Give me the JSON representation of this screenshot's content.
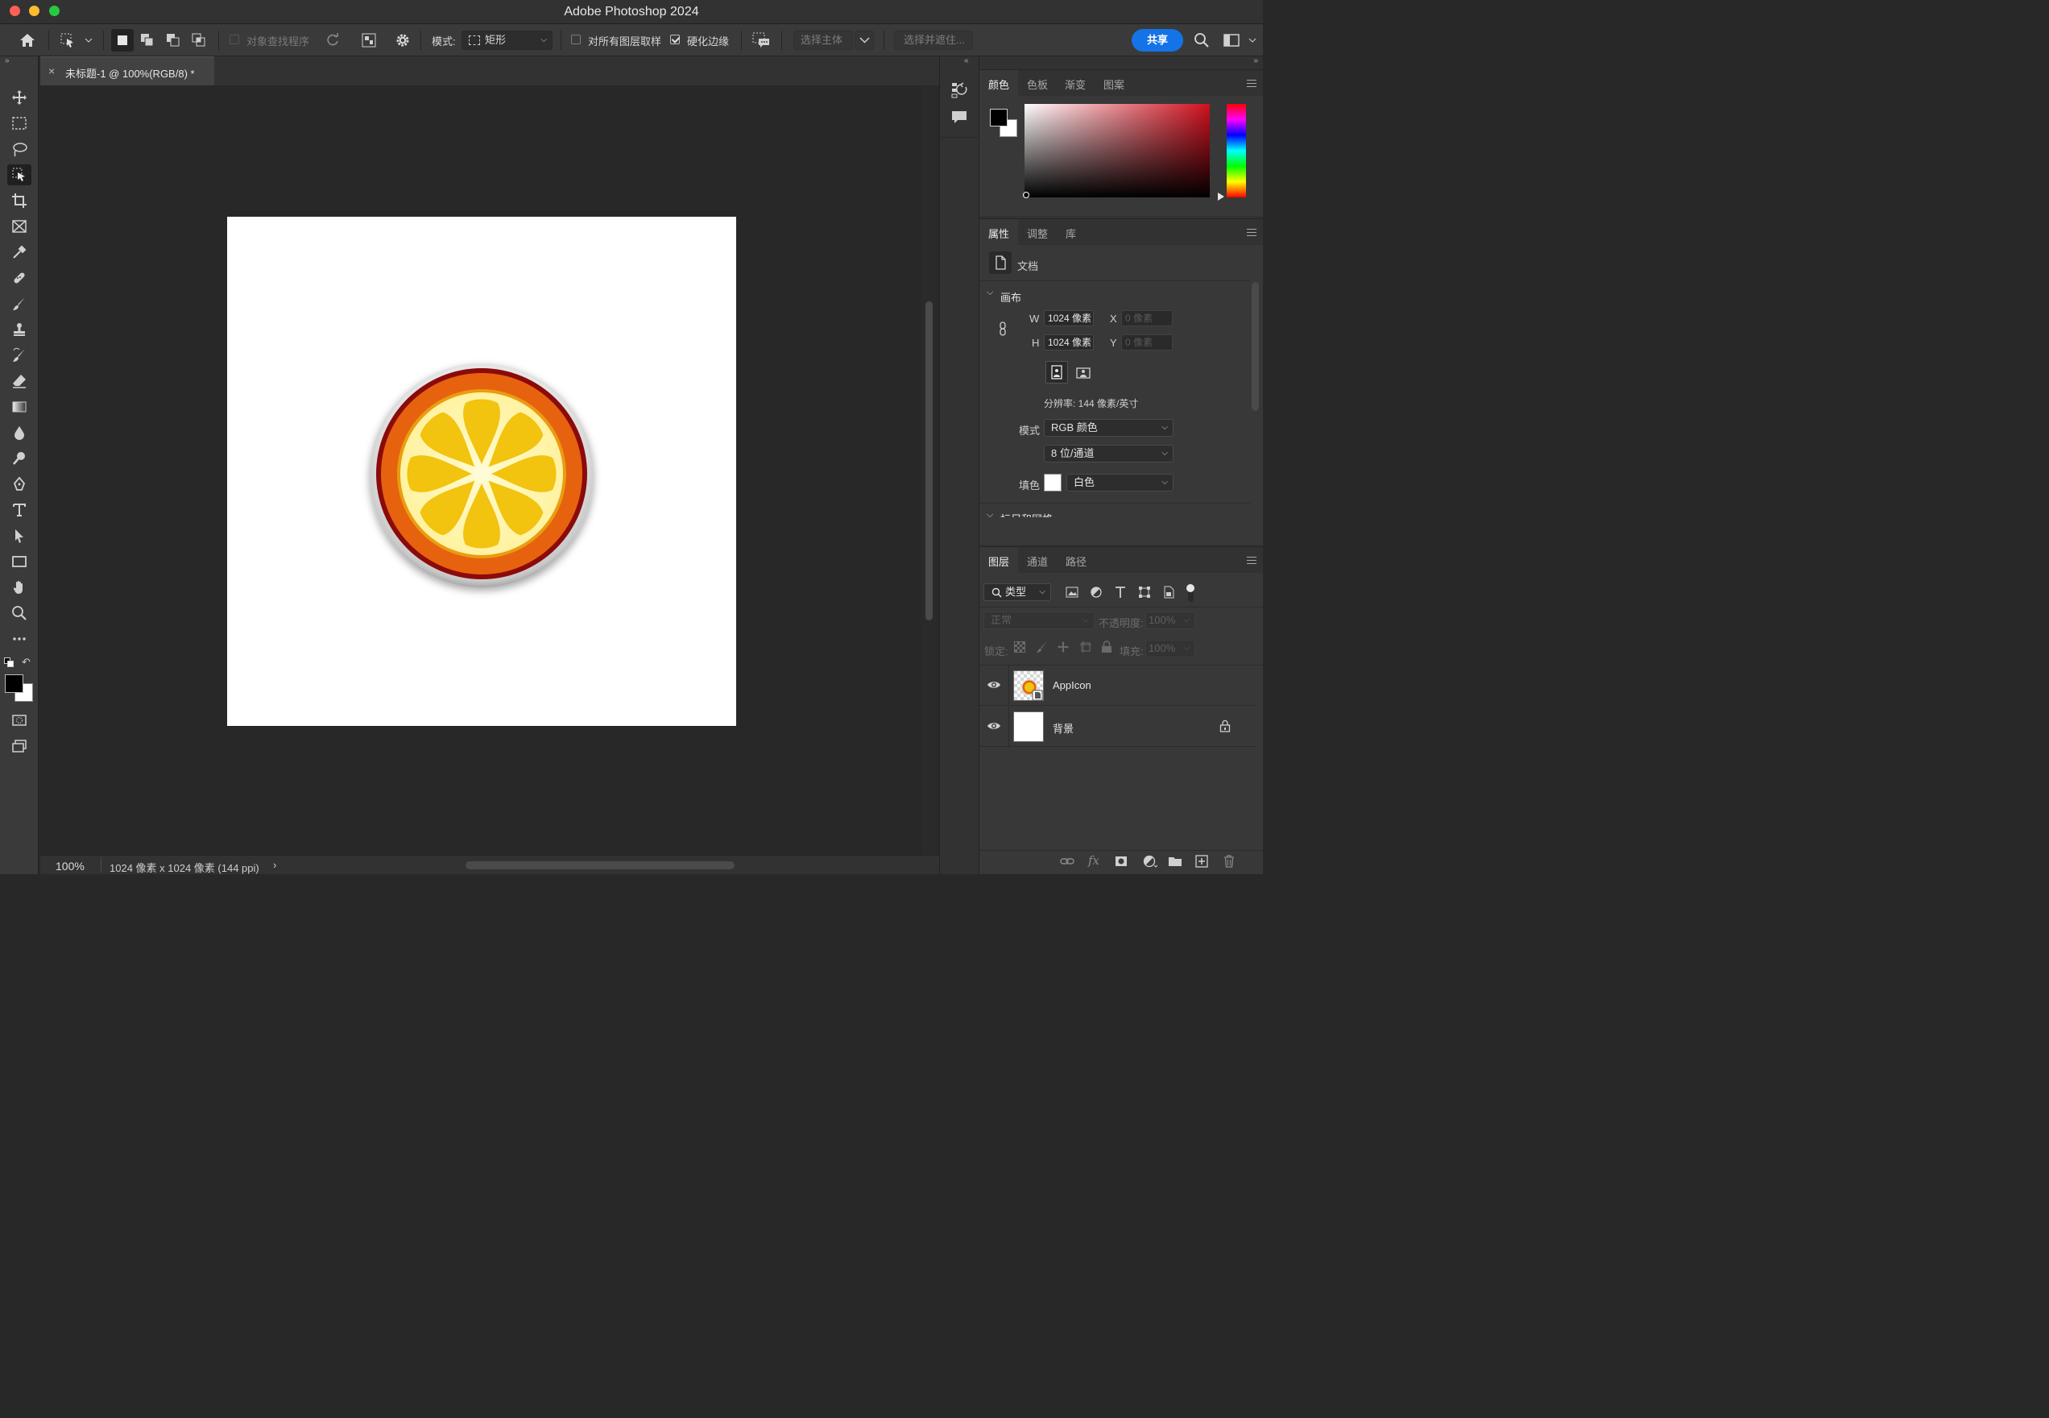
{
  "app": {
    "title": "Adobe Photoshop 2024"
  },
  "options_bar": {
    "object_finder_label": "对象查找程序",
    "mode_label": "模式:",
    "mode_value": "矩形",
    "sample_all_layers_label": "对所有图层取样",
    "sample_all_layers_checked": false,
    "hard_edge_label": "硬化边缘",
    "hard_edge_checked": true,
    "select_subject_label": "选择主体",
    "select_and_mask_label": "选择并遮住...",
    "share_label": "共享"
  },
  "document": {
    "tab_title": "未标题-1 @ 100%(RGB/8) *",
    "zoom": "100%",
    "status_info": "1024 像素 x 1024 像素 (144 ppi)"
  },
  "color_panel": {
    "tabs": [
      "颜色",
      "色板",
      "渐变",
      "图案"
    ],
    "active_tab": "颜色",
    "foreground": "#000000",
    "background": "#ffffff",
    "hue_color": "#d0101e"
  },
  "properties_panel": {
    "tabs": [
      "属性",
      "调整",
      "库"
    ],
    "active_tab": "属性",
    "doc_label": "文档",
    "canvas_section": "画布",
    "w_label": "W",
    "w_value": "1024 像素",
    "h_label": "H",
    "h_value": "1024 像素",
    "x_label": "X",
    "x_placeholder": "0 像素",
    "y_label": "Y",
    "y_placeholder": "0 像素",
    "resolution": "分辨率: 144 像素/英寸",
    "mode_label": "模式",
    "mode_value": "RGB 颜色",
    "depth_value": "8 位/通道",
    "fill_label": "填色",
    "fill_value": "白色",
    "next_section": "标尺和网格"
  },
  "layers_panel": {
    "tabs": [
      "图层",
      "通道",
      "路径"
    ],
    "active_tab": "图层",
    "filter_label": "类型",
    "blend_mode": "正常",
    "opacity_label": "不透明度:",
    "opacity_value": "100%",
    "lock_label": "锁定:",
    "fill_label": "填充:",
    "fill_value": "100%",
    "layers": [
      {
        "name": "AppIcon",
        "visible": true,
        "locked": false
      },
      {
        "name": "背景",
        "visible": true,
        "locked": true
      }
    ]
  }
}
